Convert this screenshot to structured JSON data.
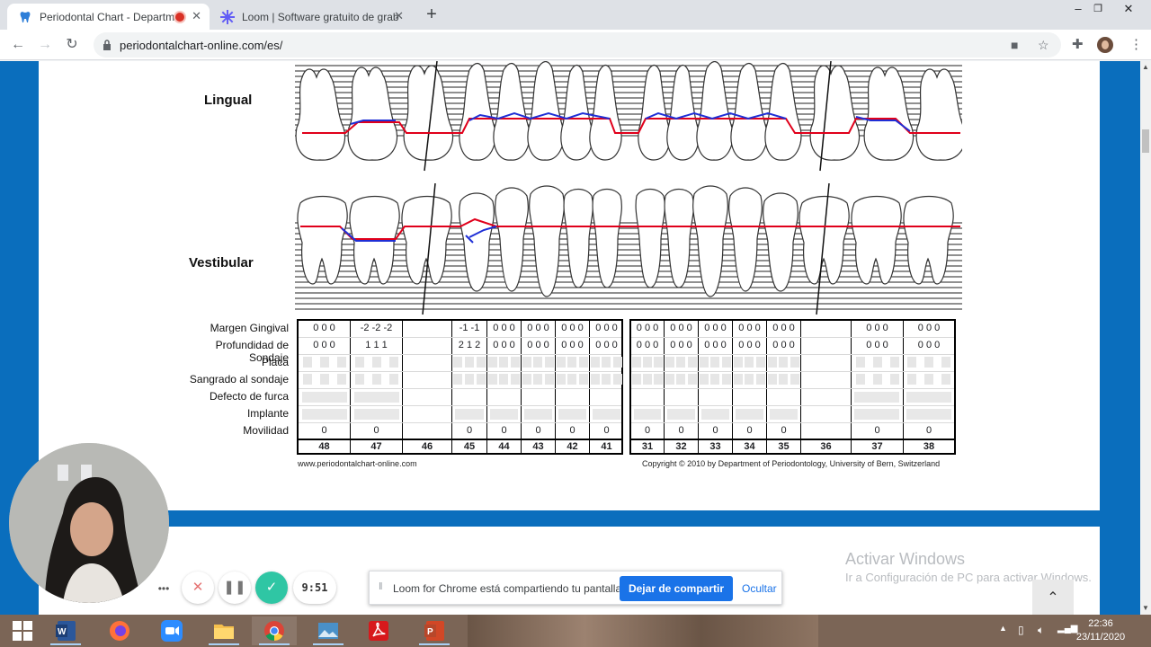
{
  "tabs": [
    {
      "title": "Periodontal Chart - Departm",
      "active": true,
      "icon": "tooth-favicon"
    },
    {
      "title": "Loom | Software gratuito de grab",
      "active": false,
      "icon": "loom-favicon"
    }
  ],
  "window_controls": {
    "minimize": "–",
    "restore": "❐",
    "close": "✕"
  },
  "toolbar": {
    "url": "periodontalchart-online.com/es/"
  },
  "chart": {
    "lingual_label": "Lingual",
    "vestibular_label": "Vestibular",
    "row_labels": [
      "Margen Gingival",
      "Profundidad de Sondaje",
      "Placa",
      "Sangrado al sondaje",
      "Defecto de furca",
      "Implante",
      "Movilidad"
    ],
    "teeth_right": [
      {
        "num": "48",
        "margen": "0 0 0",
        "sondaje": "0 0 0",
        "movilidad": "0"
      },
      {
        "num": "47",
        "margen": "-2 -2 -2",
        "sondaje": "1 1 1",
        "movilidad": "0"
      },
      {
        "num": "46",
        "margen": "",
        "sondaje": "",
        "movilidad": ""
      },
      {
        "num": "45",
        "margen": "-1 -1",
        "sondaje": "2 1 2",
        "movilidad": "0"
      },
      {
        "num": "44",
        "margen": "0 0 0",
        "sondaje": "0 0 0",
        "movilidad": "0"
      },
      {
        "num": "43",
        "margen": "0 0 0",
        "sondaje": "0 0 0",
        "movilidad": "0"
      },
      {
        "num": "42",
        "margen": "0 0 0",
        "sondaje": "0 0 0",
        "movilidad": "0"
      },
      {
        "num": "41",
        "margen": "0 0 0",
        "sondaje": "0 0 0",
        "movilidad": "0"
      }
    ],
    "teeth_left": [
      {
        "num": "31",
        "margen": "0 0 0",
        "sondaje": "0 0 0",
        "movilidad": "0"
      },
      {
        "num": "32",
        "margen": "0 0 0",
        "sondaje": "0 0 0",
        "movilidad": "0"
      },
      {
        "num": "33",
        "margen": "0 0 0",
        "sondaje": "0 0 0",
        "movilidad": "0"
      },
      {
        "num": "34",
        "margen": "0 0 0",
        "sondaje": "0 0 0",
        "movilidad": "0"
      },
      {
        "num": "35",
        "margen": "0 0 0",
        "sondaje": "0 0 0",
        "movilidad": "0"
      },
      {
        "num": "36",
        "margen": "",
        "sondaje": "",
        "movilidad": ""
      },
      {
        "num": "37",
        "margen": "0 0 0",
        "sondaje": "0 0 0",
        "movilidad": "0"
      },
      {
        "num": "38",
        "margen": "0 0 0",
        "sondaje": "0 0 0",
        "movilidad": "0"
      }
    ],
    "footer_left": "www.periodontalchart-online.com",
    "footer_right": "Copyright © 2010 by Department of Periodontology, University of Bern, Switzerland"
  },
  "windows_watermark": {
    "title": "Activar Windows",
    "subtitle": "Ir a Configuración de PC para activar Windows."
  },
  "loom": {
    "share_message": "Loom for Chrome está compartiendo tu pantalla.",
    "stop_button": "Dejar de compartir",
    "hide_link": "Ocultar",
    "timer": "9:51"
  },
  "taskbar": {
    "apps": [
      "start-icon",
      "word-icon",
      "firefox-icon",
      "zoom-icon",
      "file-explorer-icon",
      "chrome-icon",
      "photos-icon",
      "acrobat-icon",
      "powerpoint-icon"
    ],
    "time": "22:36",
    "date": "23/11/2020"
  },
  "colors": {
    "accent": "#1a73e8",
    "page_bg": "#0a6ebd",
    "gingival_red": "#e0001b",
    "probe_blue": "#1f2fd6"
  }
}
